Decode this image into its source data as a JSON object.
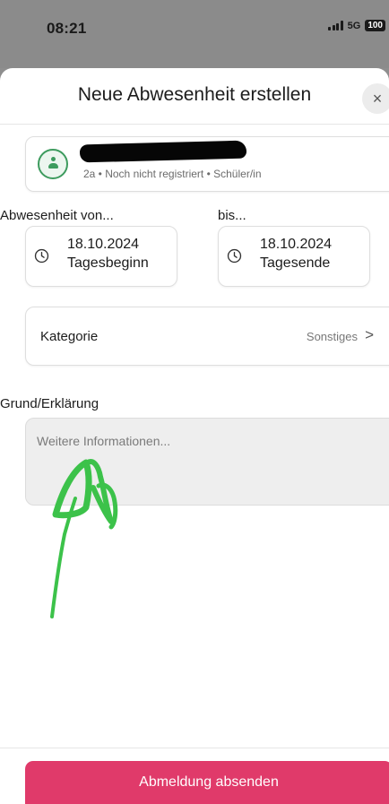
{
  "status_bar": {
    "time": "08:21",
    "network": "5G",
    "battery": "100"
  },
  "dialog": {
    "title": "Neue Abwesenheit erstellen",
    "close_label": "×"
  },
  "person": {
    "meta": "2a • Noch nicht registriert • Schüler/in"
  },
  "absence": {
    "from_label": "Abwesenheit von...",
    "to_label": "bis...",
    "from_date": "18.10.2024",
    "from_time": "Tagesbeginn",
    "to_date": "18.10.2024",
    "to_time": "Tagesende"
  },
  "category": {
    "label": "Kategorie",
    "value": "Sonstiges",
    "chevron": ">"
  },
  "reason": {
    "label": "Grund/Erklärung",
    "placeholder": "Weitere Informationen..."
  },
  "submit_label": "Abmeldung absenden",
  "colors": {
    "accent": "#e03a6a",
    "avatar_green": "#3d9b5e",
    "annotation_green": "#3cc24a"
  }
}
